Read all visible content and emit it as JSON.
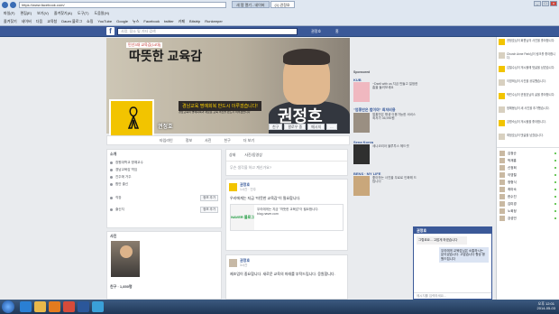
{
  "browser": {
    "address": "https://www.facebook.com/",
    "tabs": [
      {
        "label": "새 탭 열기 - 네이버",
        "active": false
      },
      {
        "label": "(1) 권정호",
        "active": true
      }
    ],
    "menu": [
      "파일(F)",
      "편집(E)",
      "보기(V)",
      "즐겨찾기(A)",
      "도구(T)",
      "도움말(H)"
    ],
    "favorites": [
      "즐겨찾기",
      "네이버",
      "다음",
      "교육청",
      "Daum 블로그",
      "쇼핑",
      "YouTube",
      "Google",
      "뉴스",
      "Facebook",
      "twitter",
      "카페",
      "Bitstrip",
      "Runkeeper"
    ],
    "window_controls": [
      "_",
      "□",
      "x"
    ]
  },
  "facebook": {
    "logo": "f",
    "search_placeholder": "사람, 장소 및 기타 검색",
    "user": "권정호",
    "home": "홈"
  },
  "cover": {
    "badge": "민선3대 교육감(14대)",
    "title": "따뜻한 교육감",
    "slogan": "경남교육 명예회복 반드시 이루겠습니다!",
    "slogan_detail": "경남교육의 명예회복과 새로운 교육 혁신을 반드시 이루겠습니다",
    "big_name": "권정호",
    "profile_name": "권정호",
    "buttons": [
      "친구",
      "팔로우 중",
      "메시지",
      "..."
    ]
  },
  "tabs": [
    "타임라인",
    "정보",
    "사진",
    "친구",
    "더 보기"
  ],
  "intro": {
    "title": "소개",
    "rows": [
      {
        "text": "창원대학교 명예교수",
        "button": ""
      },
      {
        "text": "경남교육감 역임",
        "button": ""
      },
      {
        "text": "진주에 거주",
        "button": ""
      },
      {
        "text": "함안 출신",
        "button": ""
      },
      {
        "text": "직장",
        "button": "정보 추가"
      },
      {
        "text": "출신지",
        "button": "정보 추가"
      }
    ]
  },
  "photos_card": {
    "title": "사진",
    "friends_label": "친구 · 1,850명"
  },
  "composer": {
    "tabs": [
      "상태",
      "사진/동영상"
    ],
    "placeholder": "무슨 생각을 하고 계신가요?"
  },
  "posts": [
    {
      "name": "권정호",
      "time": "1시간 · 진주",
      "text": "우리에게는 지금 \"따뜻한 교육감\"이 필요합니다.",
      "link_thumb": "NAVER 블로그",
      "link_title": "우리에게는 지금 \"따뜻한 교육감\"이 필요합니다.",
      "link_url": "blog.naver.com"
    },
    {
      "name": "권정호",
      "time": "3시간",
      "text": "제조업이 중요합니다. 새로운 교육의 미래를 부탁드립니다. 응원합니다."
    }
  ],
  "right": {
    "sponsored": "Sponsored",
    "ads": [
      {
        "title": "KUB",
        "text": "~Dsell with us 지금 만들고 일정한 홈을 둘러보세요"
      },
      {
        "title": "\"엄홍만은 법이야\" 최저비용",
        "text": "얼홍만은 평생 이용가능한 서비스 최저가 36,990원"
      },
      {
        "title": "Sena Korea",
        "text": "세나코리아 블루투스 헤드셋"
      },
      {
        "title": "BENS · MY LIFE",
        "text": "좋아하는 사진을 무료로 인화해 드립니다"
      }
    ]
  },
  "ticker": [
    "권정호님이 회원님의 사진을 좋아합니다.",
    "Church Anne Park님이 링크를 좋아합니다.",
    "김철수님이 게시물에 댓글을 남겼습니다.",
    "이영희님이 사진을 공유했습니다.",
    "박민수님이 권정호님의 글을 좋아합니다.",
    "정해봉님이 새 사진을 추가했습니다.",
    "강명숙님이 게시물을 좋아합니다.",
    "최정호님이 댓글을 남겼습니다."
  ],
  "chat_list": [
    "김정순",
    "박재홍",
    "신정희",
    "이영철",
    "정형식",
    "최미숙",
    "한수진",
    "김미경",
    "노희정",
    "강성민"
  ],
  "chat_window": {
    "name": "권정호",
    "incoming": "그렇죠요... 고맙게 하였습니다",
    "outgoing": "우리에게 교육감님은 소통하시는 분이셨습니다. 고맙습니다 항상 응원드립니다",
    "input_placeholder": "메시지를 입력하세요..."
  },
  "taskbar": {
    "time": "오후 12:01",
    "date": "2014-05-03"
  },
  "colors": {
    "fb_blue": "#3b5998",
    "ribbon_yellow": "#f2c400"
  }
}
